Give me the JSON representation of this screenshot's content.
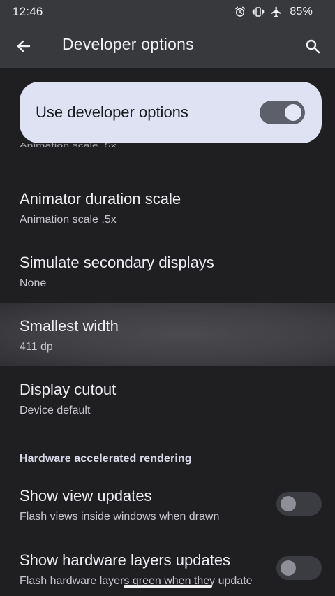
{
  "status_bar": {
    "time": "12:46",
    "battery": "85%",
    "icons": [
      "alarm-icon",
      "vibrate-icon",
      "airplane-mode-icon"
    ]
  },
  "app_bar": {
    "title": "Developer options",
    "back_icon": "back-arrow-icon",
    "search_icon": "search-icon"
  },
  "master": {
    "label": "Use developer options",
    "enabled": true
  },
  "list": {
    "partial_subtitle": "Animation scale .5x",
    "items": [
      {
        "title": "Animator duration scale",
        "subtitle": "Animation scale .5x"
      },
      {
        "title": "Simulate secondary displays",
        "subtitle": "None"
      },
      {
        "title": "Smallest width",
        "subtitle": "411 dp"
      },
      {
        "title": "Display cutout",
        "subtitle": "Device default"
      }
    ],
    "section_header": "Hardware accelerated rendering",
    "toggle_items": [
      {
        "title": "Show view updates",
        "subtitle": "Flash views inside windows when drawn",
        "enabled": false
      },
      {
        "title": "Show hardware layers updates",
        "subtitle": "Flash hardware layers green when they update",
        "enabled": false
      }
    ]
  },
  "colors": {
    "background": "#1f1f22",
    "app_bar": "#38393c",
    "card": "#dfe2f3",
    "text_primary": "#efedf2",
    "text_secondary": "#c8c7cf"
  }
}
